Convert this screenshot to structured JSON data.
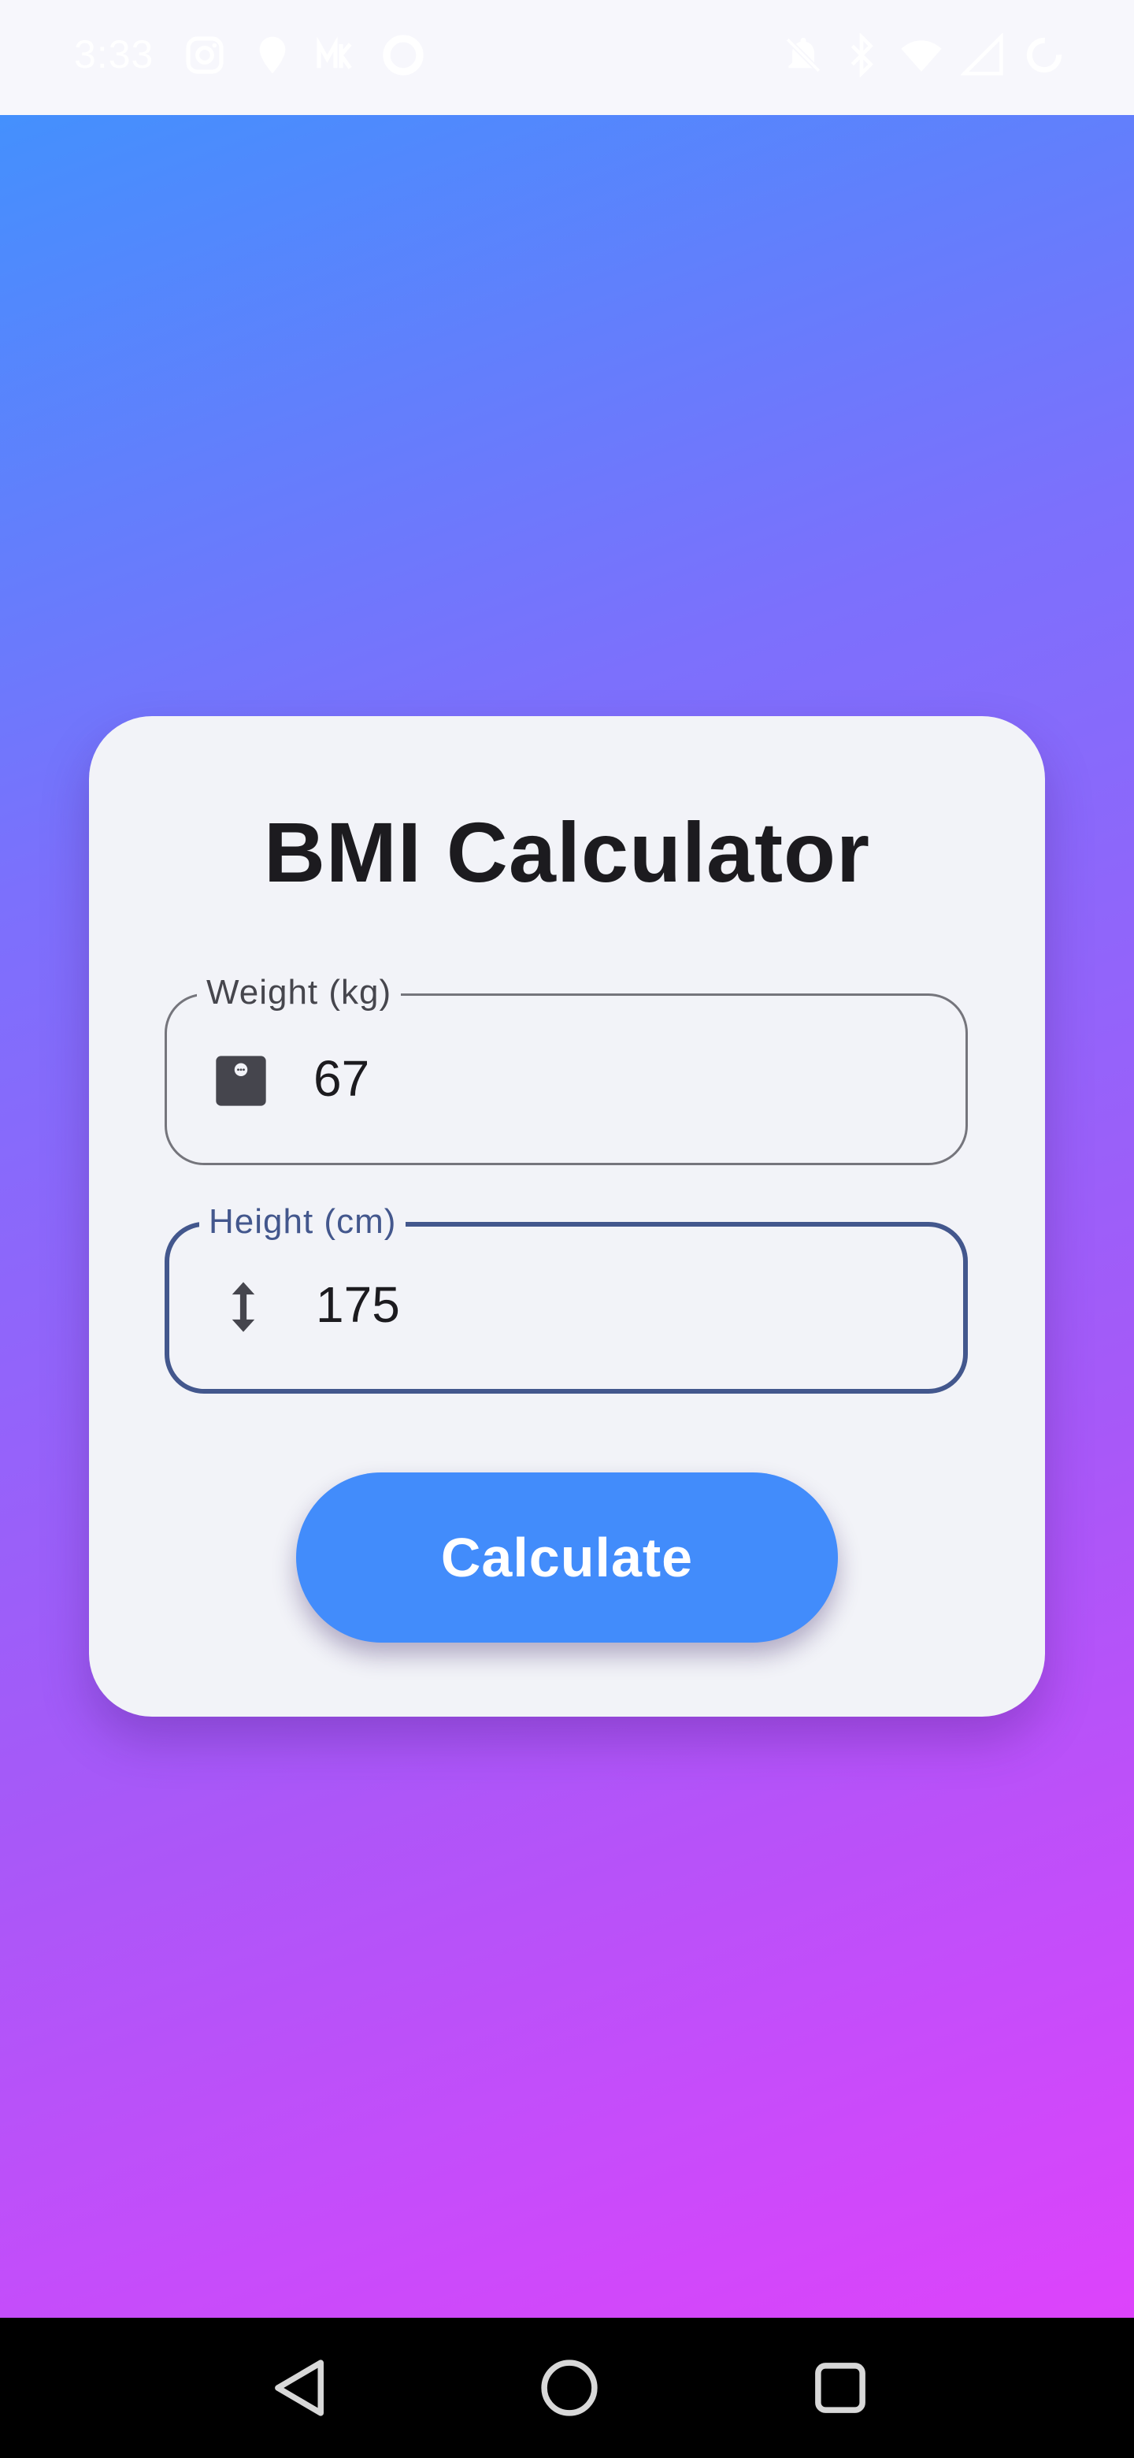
{
  "status_bar": {
    "time": "3:33",
    "left_icons": [
      "instagram-icon",
      "location-pin-icon",
      "app-badge-icon",
      "circle-app-icon"
    ],
    "right_icons": [
      "notifications-off-icon",
      "bluetooth-icon",
      "wifi-icon",
      "signal-icon",
      "battery-saver-icon"
    ]
  },
  "card": {
    "title": "BMI Calculator",
    "weight": {
      "label": "Weight (kg)",
      "value": "67",
      "icon": "scale-icon"
    },
    "height": {
      "label": "Height (cm)",
      "value": "175",
      "icon": "vertical-arrows-icon",
      "focused": true
    },
    "calculate_label": "Calculate"
  },
  "nav_bar": {
    "buttons": [
      "back-icon",
      "home-icon",
      "recents-icon"
    ]
  },
  "colors": {
    "gradient_start": "#4490fd",
    "gradient_end": "#dd43fb",
    "card_background": "#f2f3f8",
    "focused_border": "#43578d",
    "button_background": "#428cfb",
    "title_text": "#1c1b1f"
  }
}
